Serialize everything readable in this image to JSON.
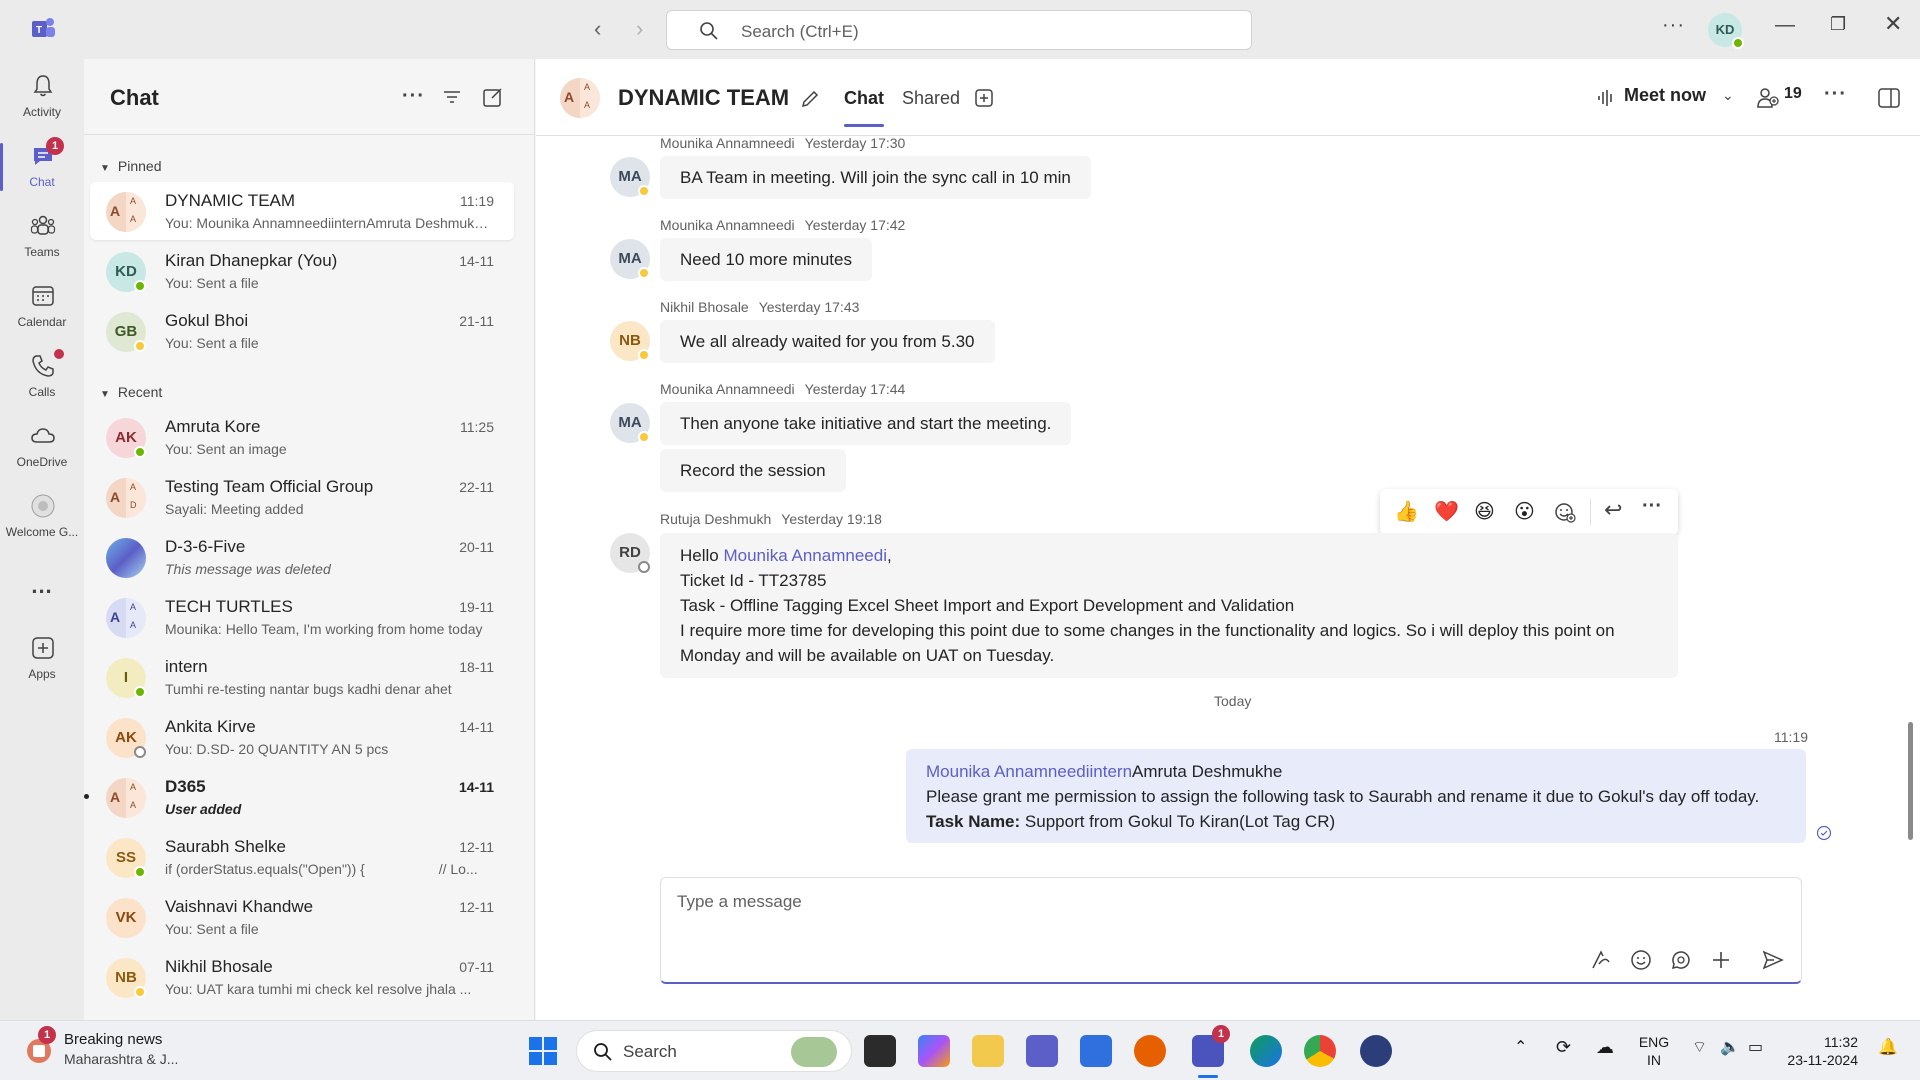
{
  "titlebar": {
    "search_placeholder": "Search (Ctrl+E)",
    "avatar_initials": "KD"
  },
  "rail": {
    "items": [
      {
        "label": "Activity",
        "icon": "bell-icon"
      },
      {
        "label": "Chat",
        "icon": "chat-icon",
        "badge": "1"
      },
      {
        "label": "Teams",
        "icon": "teams-icon"
      },
      {
        "label": "Calendar",
        "icon": "calendar-icon"
      },
      {
        "label": "Calls",
        "icon": "phone-icon"
      },
      {
        "label": "OneDrive",
        "icon": "cloud-icon"
      },
      {
        "label": "Welcome G...",
        "icon": "welcome-icon"
      },
      {
        "label": "Apps",
        "icon": "apps-icon"
      }
    ],
    "more_label": "..."
  },
  "chatlist": {
    "title": "Chat",
    "pinned_label": "Pinned",
    "recent_label": "Recent",
    "pinned": [
      {
        "avatar": "A",
        "name": "DYNAMIC TEAM",
        "preview": "You: Mounika AnnamneediinternAmruta Deshmukhe Please grant me permission",
        "time": "11:19",
        "selected": true
      },
      {
        "avatar": "KD",
        "name": "Kiran Dhanepkar (You)",
        "preview": "You: Sent a file",
        "time": "14-11"
      },
      {
        "avatar": "GB",
        "name": "Gokul Bhoi",
        "preview": "You: Sent a file",
        "time": "21-11"
      }
    ],
    "recent": [
      {
        "avatar": "AK",
        "name": "Amruta Kore",
        "preview": "You: Sent an image",
        "time": "11:25"
      },
      {
        "avatar": "A",
        "name": "Testing Team Official Group",
        "preview": "Sayali: Meeting added",
        "time": "22-11"
      },
      {
        "avatar": "",
        "name": "D-3-6-Five",
        "preview": "This message was deleted",
        "time": "20-11"
      },
      {
        "avatar": "A",
        "name": "TECH TURTLES",
        "preview": "Mounika: Hello Team, I'm working from home today",
        "time": "19-11"
      },
      {
        "avatar": "I",
        "name": "intern",
        "preview": "Tumhi re-testing nantar bugs kadhi denar ahet",
        "time": "18-11"
      },
      {
        "avatar": "AK",
        "name": "Ankita Kirve",
        "preview": "You: D.SD- 20  QUANTITY AN 5 pcs",
        "time": "14-11"
      },
      {
        "avatar": "A",
        "name": "D365",
        "preview": "User added",
        "time": "14-11",
        "unread": true
      },
      {
        "avatar": "SS",
        "name": "Saurabh Shelke",
        "preview": "if (orderStatus.equals(\"Open\")) {                   // Lo...",
        "time": "12-11"
      },
      {
        "avatar": "VK",
        "name": "Vaishnavi Khandwe",
        "preview": "You: Sent a file",
        "time": "12-11"
      },
      {
        "avatar": "NB",
        "name": "Nikhil Bhosale",
        "preview": "You: UAT kara tumhi mi check kel resolve jhala ...",
        "time": "07-11"
      }
    ]
  },
  "conversation": {
    "title": "DYNAMIC TEAM",
    "tabs": [
      "Chat",
      "Shared"
    ],
    "meet_now_label": "Meet now",
    "participants_count": "19",
    "messages": [
      {
        "avatar": "MA",
        "sender": "Mounika Annamneedi",
        "time": "Yesterday 17:30",
        "text": "BA Team in meeting. Will join the sync call in 10 min"
      },
      {
        "avatar": "MA",
        "sender": "Mounika Annamneedi",
        "time": "Yesterday 17:42",
        "text": "Need 10 more minutes"
      },
      {
        "avatar": "NB",
        "sender": "Nikhil Bhosale",
        "time": "Yesterday 17:43",
        "text": "We all already waited for you from 5.30"
      },
      {
        "avatar": "MA",
        "sender": "Mounika Annamneedi",
        "time": "Yesterday 17:44",
        "text": "Then anyone take initiative and start the meeting.",
        "text2": "Record the session"
      }
    ],
    "long_message": {
      "avatar": "RD",
      "sender": "Rutuja Deshmukh",
      "time": "Yesterday 19:18",
      "greeting": "Hello ",
      "mention": "Mounika Annamneedi",
      "greeting_suffix": ",",
      "line2": "Ticket Id - TT23785",
      "line3": "Task - Offline Tagging Excel Sheet Import and Export Development and Validation",
      "line4": "I require more time for developing this point due to some changes in the functionality and logics. So i will deploy this point on",
      "line5": "Monday and will be available on UAT on Tuesday."
    },
    "reactions": [
      "👍",
      "❤️",
      "😆",
      "😮"
    ],
    "today_label": "Today",
    "my_message": {
      "time": "11:19",
      "mention1": "Mounika Annamneedi",
      "mention2": "intern",
      "name_after": "Amruta Deshmukhe",
      "line2": "Please grant me permission to assign the following task to Saurabh and rename it due to Gokul's day off today.",
      "task_label": "Task Name:",
      "task_value": " Support from Gokul To Kiran(Lot Tag CR)"
    },
    "compose_placeholder": "Type a message"
  },
  "taskbar": {
    "news_title": "Breaking news",
    "news_sub": "Maharashtra & J...",
    "news_badge": "1",
    "search_label": "Search",
    "teams_badge": "1",
    "lang_line1": "ENG",
    "lang_line2": "IN",
    "clock_time": "11:32",
    "clock_date": "23-11-2024"
  },
  "colors": {
    "accent": "#5b5fc7",
    "badge": "#c4314b",
    "presence_available": "#6bb700",
    "presence_away": "#f8c93a",
    "my_bubble": "#e8ebfa"
  }
}
